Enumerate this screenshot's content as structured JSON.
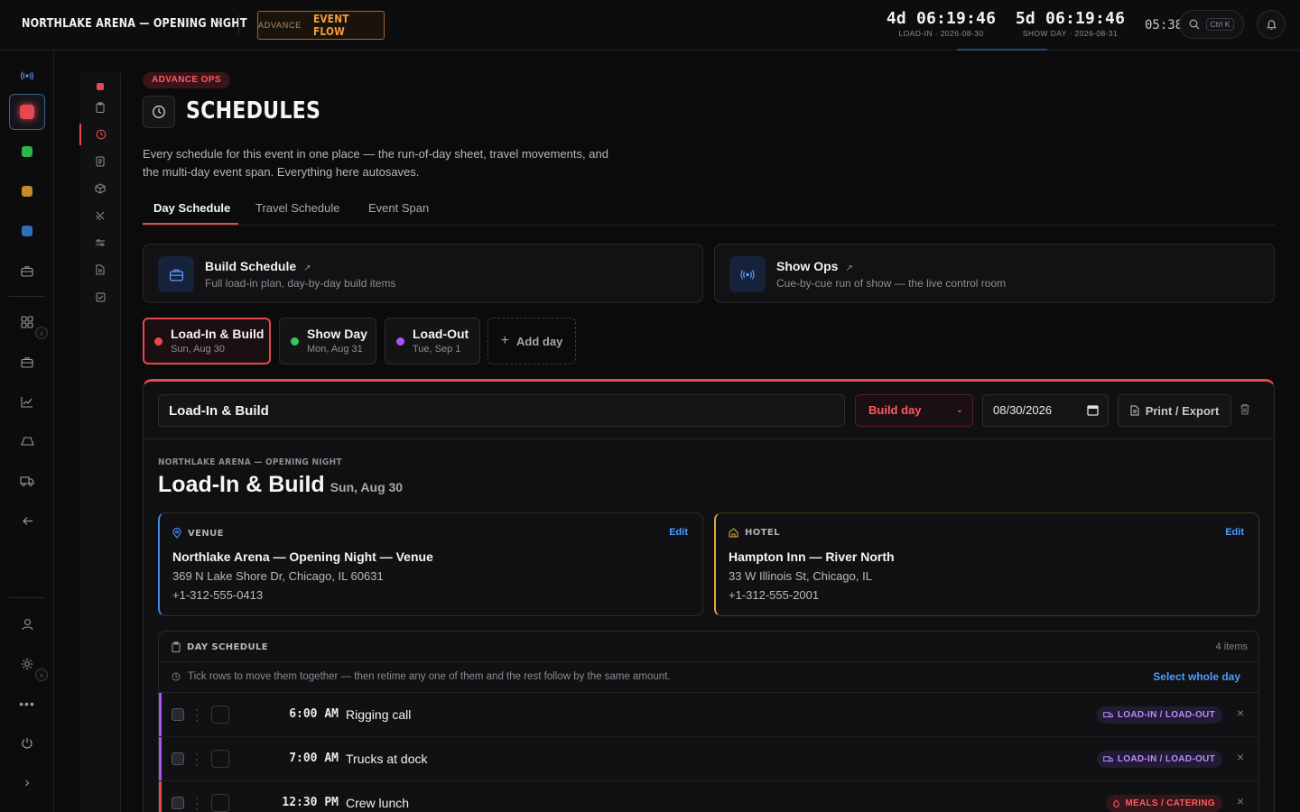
{
  "topbar": {
    "event_title": "NORTHLAKE ARENA — OPENING NIGHT",
    "advance_small": "ADVANCE",
    "advance_big": "EVENT FLOW",
    "countdown_loadin": {
      "value": "4d 06:19:46",
      "label": "LOAD-IN · 2026-08-30"
    },
    "countdown_show": {
      "value": "5d 06:19:46",
      "label": "SHOW DAY · 2026-08-31"
    },
    "clock": "05:38",
    "search_shortcut": "Ctrl K"
  },
  "colors": {
    "accent_red": "#e5484d",
    "accent_blue": "#4d9bff",
    "accent_orange": "#f59a3a",
    "loadout_purple": "#a855f7",
    "showday_green": "#34c759"
  },
  "rail": {
    "icons": [
      "broadcast-icon",
      "red-module-icon",
      "green-module-icon",
      "amber-module-icon",
      "blue-module-icon",
      "briefcase-icon",
      "grid-icon",
      "briefcase-icon",
      "chart-icon",
      "stage-icon",
      "truck-icon",
      "back-arrow-icon",
      "user-icon",
      "settings-icon",
      "more-icon",
      "power-icon",
      "expand-icon"
    ]
  },
  "page": {
    "badge": "ADVANCE OPS",
    "title": "SCHEDULES",
    "description": "Every schedule for this event in one place — the run-of-day sheet, travel movements, and the multi-day event span. Everything here autosaves.",
    "tabs": [
      "Day Schedule",
      "Travel Schedule",
      "Event Span"
    ]
  },
  "cards": {
    "build": {
      "title": "Build Schedule",
      "subtitle": "Full load-in plan, day-by-day build items"
    },
    "show": {
      "title": "Show Ops",
      "subtitle": "Cue-by-cue run of show — the live control room"
    }
  },
  "days": [
    {
      "name": "Load-In & Build",
      "date": "Sun, Aug 30"
    },
    {
      "name": "Show Day",
      "date": "Mon, Aug 31"
    },
    {
      "name": "Load-Out",
      "date": "Tue, Sep 1"
    }
  ],
  "add_day": "Add day",
  "editor": {
    "name_value": "Load-In & Build",
    "type_value": "Build day",
    "date_value": "08/30/2026",
    "print_label": "Print / Export"
  },
  "doc": {
    "eyebrow": "NORTHLAKE ARENA — OPENING NIGHT",
    "title": "Load-In & Build",
    "date": "Sun, Aug 30"
  },
  "venue": {
    "label": "VENUE",
    "edit": "Edit",
    "name": "Northlake Arena — Opening Night — Venue",
    "address": "369 N Lake Shore Dr, Chicago, IL 60631",
    "phone": "+1-312-555-0413"
  },
  "hotel": {
    "label": "HOTEL",
    "edit": "Edit",
    "name": "Hampton Inn — River North",
    "address": "33 W Illinois St, Chicago, IL",
    "phone": "+1-312-555-2001"
  },
  "schedule": {
    "title": "DAY SCHEDULE",
    "count": "4 items",
    "hint": "Tick rows to move them together — then retime any one of them and the rest follow by the same amount.",
    "select_whole_day": "Select whole day",
    "rows": [
      {
        "time": "6:00 AM",
        "label": "Rigging call",
        "tag": "LOAD-IN / LOAD-OUT"
      },
      {
        "time": "7:00 AM",
        "label": "Trucks at dock",
        "tag": "LOAD-IN / LOAD-OUT"
      },
      {
        "time": "12:30 PM",
        "label": "Crew lunch",
        "tag": "MEALS / CATERING"
      }
    ]
  }
}
